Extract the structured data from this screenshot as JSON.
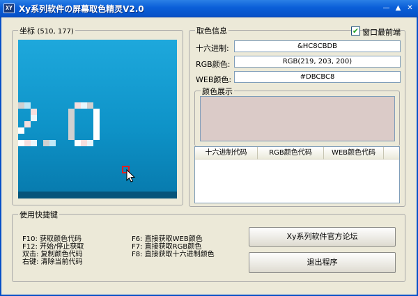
{
  "window": {
    "title": "Xy系列软件の屏幕取色精灵V2.0",
    "app_icon_text": "XY"
  },
  "titlebar_buttons": {
    "minimize": "—",
    "maximize": "▲",
    "close": "✕"
  },
  "coordinates": {
    "label": "坐标",
    "value": "(510, 177)"
  },
  "preview": {
    "text": "2.0",
    "background": "#0e93c8"
  },
  "color_info": {
    "group_label": "取色信息",
    "always_on_top_label": "窗口最前端",
    "always_on_top_checked": true,
    "hex_label": "十六进制:",
    "hex_value": "&HC8CBDB",
    "rgb_label": "RGB颜色:",
    "rgb_value": "RGB(219, 203, 200)",
    "web_label": "WEB颜色:",
    "web_value": "#DBCBC8"
  },
  "color_display": {
    "group_label": "颜色展示",
    "swatch_color": "#DBCBC8"
  },
  "history": {
    "columns": [
      "十六进制代码",
      "RGB颜色代码",
      "WEB颜色代码"
    ],
    "rows": []
  },
  "shortcuts": {
    "group_label": "使用快捷键",
    "left": [
      "F10:  获取颜色代码",
      "F12: 开始/停止获取",
      "双击: 复制颜色代码",
      "右键: 清除当前代码"
    ],
    "right": [
      "F6: 直接获取WEB颜色",
      "F7: 直接获取RGB颜色",
      "F8: 直接获取十六进制颜色"
    ]
  },
  "buttons": {
    "forum": "Xy系列软件官方论坛",
    "exit": "退出程序"
  },
  "colors": {
    "titlebar": "#0a5fd8",
    "window_bg": "#ece9d8",
    "preview_bg": "#0e93c8"
  }
}
